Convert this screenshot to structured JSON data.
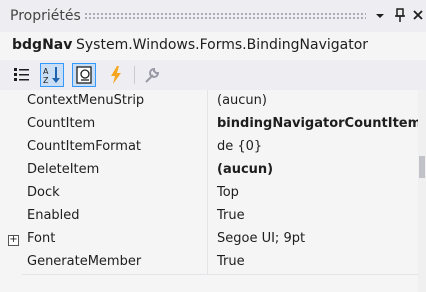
{
  "window": {
    "title": "Propriétés"
  },
  "object": {
    "name": "bdgNav",
    "type": "System.Windows.Forms.BindingNavigator"
  },
  "toolbar": {
    "buttons": [
      "categorized-icon",
      "alphabetical-icon",
      "properties-icon",
      "events-icon",
      "property-pages-icon"
    ]
  },
  "properties": [
    {
      "name": "ContextMenuStrip",
      "value": "(aucun)"
    },
    {
      "name": "CountItem",
      "value": "bindingNavigatorCountItem"
    },
    {
      "name": "CountItemFormat",
      "value": "de {0}"
    },
    {
      "name": "DeleteItem",
      "value": "(aucun)"
    },
    {
      "name": "Dock",
      "value": "Top"
    },
    {
      "name": "Enabled",
      "value": "True"
    },
    {
      "name": "Font",
      "value": "Segoe UI; 9pt"
    },
    {
      "name": "GenerateMember",
      "value": "True"
    }
  ],
  "colors": {
    "pressed_border": "#3399ff",
    "background": "#eeeef2",
    "events": "#f5a623"
  }
}
